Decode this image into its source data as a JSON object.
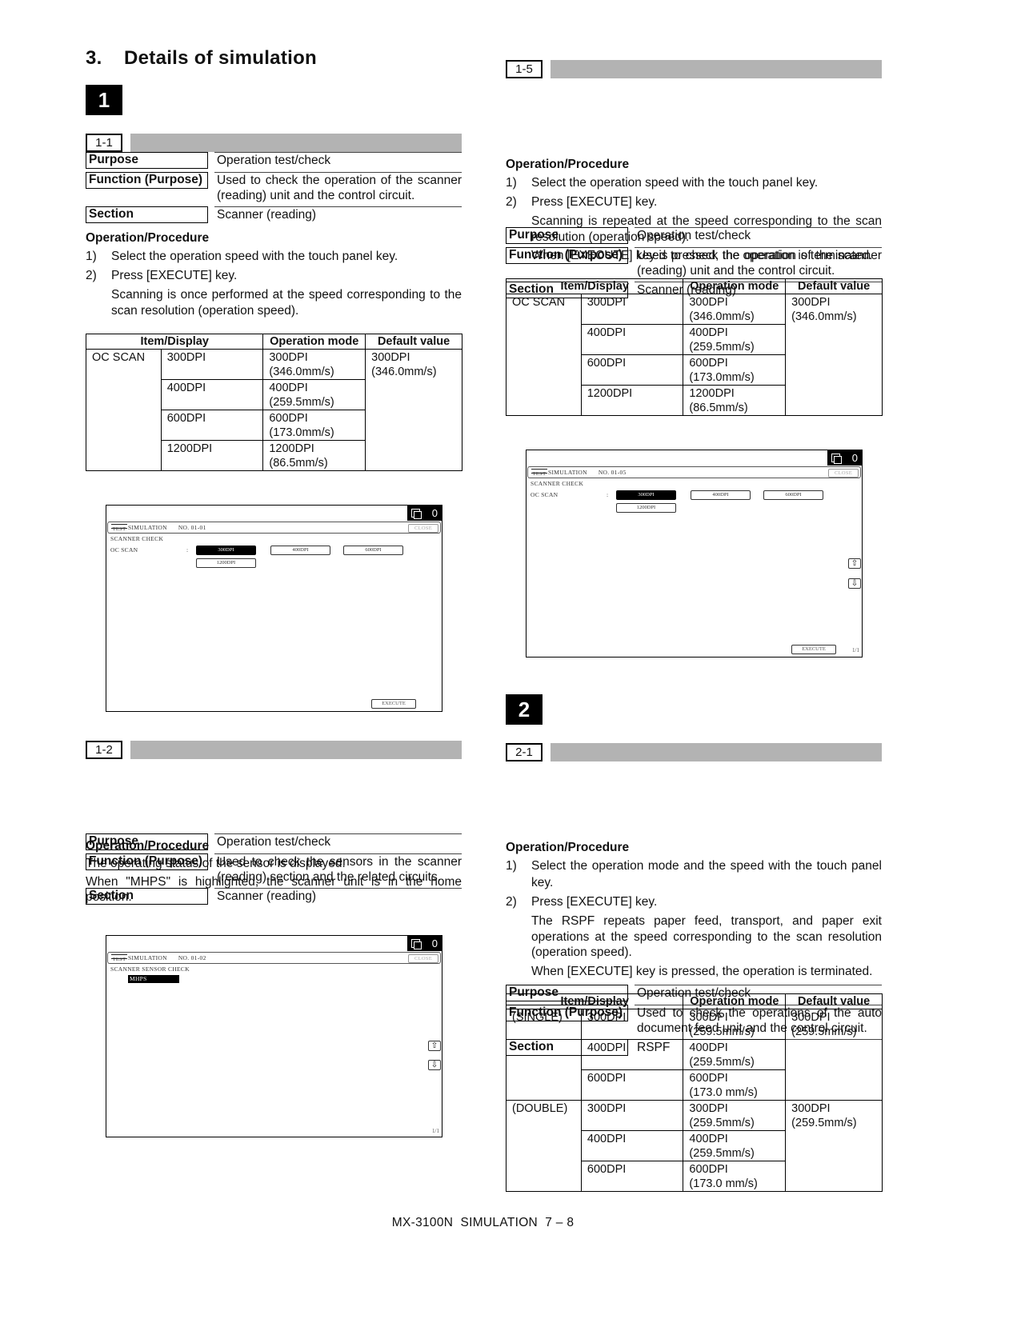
{
  "section_heading": {
    "number": "3.",
    "title": "Details of simulation"
  },
  "groups": [
    {
      "number": "1"
    },
    {
      "number": "2"
    }
  ],
  "sim_1_1": {
    "tag": "1-1",
    "purpose_label": "Purpose",
    "purpose": "Operation test/check",
    "function_label": "Function (Purpose)",
    "function": "Used to check the operation of the scanner (reading) unit and the control circuit.",
    "section_label": "Section",
    "section": "Scanner (reading)",
    "procedure_title": "Operation/Procedure",
    "steps": [
      {
        "n": "1)",
        "text": "Select the operation speed with the touch panel key."
      },
      {
        "n": "2)",
        "text": "Press [EXECUTE] key."
      }
    ],
    "notes": [
      "Scanning is once performed at the speed corresponding to the scan resolution (operation speed)."
    ],
    "table": {
      "headers": [
        "Item/Display",
        "Operation mode",
        "Default value"
      ],
      "item": "OC SCAN",
      "rows": [
        {
          "display": "300DPI",
          "mode": [
            "300DPI",
            "(346.0mm/s)"
          ]
        },
        {
          "display": "400DPI",
          "mode": [
            "400DPI",
            "(259.5mm/s)"
          ]
        },
        {
          "display": "600DPI",
          "mode": [
            "600DPI",
            "(173.0mm/s)"
          ]
        },
        {
          "display": "1200DPI",
          "mode": [
            "1200DPI",
            "(86.5mm/s)"
          ]
        }
      ],
      "default": [
        "300DPI",
        "(346.0mm/s)"
      ]
    },
    "screen": {
      "counter": "0",
      "test_logo": "TEST",
      "sim_label": "SIMULATION",
      "sim_no": "NO. 01-01",
      "close": "CLOSE",
      "heading": "SCANNER CHECK",
      "row_label": "OC SCAN",
      "colon": ":",
      "options": [
        {
          "label": "300DPI",
          "selected": true
        },
        {
          "label": "400DPI",
          "selected": false
        },
        {
          "label": "600DPI",
          "selected": false
        },
        {
          "label": "1200DPI",
          "selected": false
        }
      ],
      "execute": "EXECUTE"
    }
  },
  "sim_1_2": {
    "tag": "1-2",
    "purpose_label": "Purpose",
    "purpose": "Operation test/check",
    "function_label": "Function (Purpose)",
    "function": "Used to check the sensors in the scanner (reading) section and the related circuits.",
    "section_label": "Section",
    "section": "Scanner (reading)",
    "procedure_title": "Operation/Procedure",
    "paragraphs": [
      "The operating status of the sensor is displayed.",
      "When \"MHPS\" is highlighted, the scanner unit is in the home position."
    ],
    "screen": {
      "counter": "0",
      "test_logo": "TEST",
      "sim_label": "SIMULATION",
      "sim_no": "NO. 01-02",
      "close": "CLOSE",
      "heading": "SCANNER SENSOR CHECK",
      "sensor": "MHPS",
      "page": "1/1"
    }
  },
  "sim_1_5": {
    "tag": "1-5",
    "purpose_label": "Purpose",
    "purpose": "Operation test/check",
    "function_label": "Function (Purpose)",
    "function": "Used to check the operation of the scanner (reading) unit and the control circuit.",
    "section_label": "Section",
    "section": "Scanner (reading)",
    "procedure_title": "Operation/Procedure",
    "steps": [
      {
        "n": "1)",
        "text": "Select the operation speed with the touch panel key."
      },
      {
        "n": "2)",
        "text": "Press [EXECUTE] key."
      }
    ],
    "notes": [
      "Scanning is repeated at the speed corresponding to the scan resolution (operation speed).",
      "When [EXECUTE] key is pressed, the operation is terminated."
    ],
    "table": {
      "headers": [
        "Item/Display",
        "Operation mode",
        "Default value"
      ],
      "item": "OC SCAN",
      "rows": [
        {
          "display": "300DPI",
          "mode": [
            "300DPI",
            "(346.0mm/s)"
          ]
        },
        {
          "display": "400DPI",
          "mode": [
            "400DPI",
            "(259.5mm/s)"
          ]
        },
        {
          "display": "600DPI",
          "mode": [
            "600DPI",
            "(173.0mm/s)"
          ]
        },
        {
          "display": "1200DPI",
          "mode": [
            "1200DPI",
            "(86.5mm/s)"
          ]
        }
      ],
      "default": [
        "300DPI",
        "(346.0mm/s)"
      ]
    },
    "screen": {
      "counter": "0",
      "test_logo": "TEST",
      "sim_label": "SIMULATION",
      "sim_no": "NO. 01-05",
      "close": "CLOSE",
      "heading": "SCANNER CHECK",
      "row_label": "OC SCAN",
      "colon": ":",
      "options": [
        {
          "label": "300DPI",
          "selected": true
        },
        {
          "label": "400DPI",
          "selected": false
        },
        {
          "label": "600DPI",
          "selected": false
        },
        {
          "label": "1200DPI",
          "selected": false
        }
      ],
      "execute": "EXECUTE",
      "page": "1/1"
    }
  },
  "sim_2_1": {
    "tag": "2-1",
    "purpose_label": "Purpose",
    "purpose": "Operation test/check",
    "function_label": "Function (Purpose)",
    "function": "Used to check the operations of the auto document feed unit and the control circuit.",
    "section_label": "Section",
    "section": "RSPF",
    "procedure_title": "Operation/Procedure",
    "steps": [
      {
        "n": "1)",
        "text": "Select the operation mode and the speed with the touch panel key."
      },
      {
        "n": "2)",
        "text": "Press [EXECUTE] key."
      }
    ],
    "notes": [
      "The RSPF repeats paper feed, transport, and paper exit operations at the speed corresponding to the scan resolution (operation speed).",
      "When [EXECUTE] key is pressed, the operation is terminated."
    ],
    "table": {
      "headers": [
        "Item/Display",
        "Operation mode",
        "Default value"
      ],
      "groups": [
        {
          "item": "(SINGLE)",
          "rows": [
            {
              "display": "300DPI",
              "mode": [
                "300DPI",
                "(259.5mm/s)"
              ]
            },
            {
              "display": "400DPI",
              "mode": [
                "400DPI",
                "(259.5mm/s)"
              ]
            },
            {
              "display": "600DPI",
              "mode": [
                "600DPI",
                "(173.0 mm/s)"
              ]
            }
          ],
          "default": [
            "300DPI",
            "(259.5mm/s)"
          ]
        },
        {
          "item": "(DOUBLE)",
          "rows": [
            {
              "display": "300DPI",
              "mode": [
                "300DPI",
                "(259.5mm/s)"
              ]
            },
            {
              "display": "400DPI",
              "mode": [
                "400DPI",
                "(259.5mm/s)"
              ]
            },
            {
              "display": "600DPI",
              "mode": [
                "600DPI",
                "(173.0 mm/s)"
              ]
            }
          ],
          "default": [
            "300DPI",
            "(259.5mm/s)"
          ]
        }
      ]
    }
  },
  "footer": {
    "text": "MX-3100N  SIMULATION  7 – 8"
  }
}
